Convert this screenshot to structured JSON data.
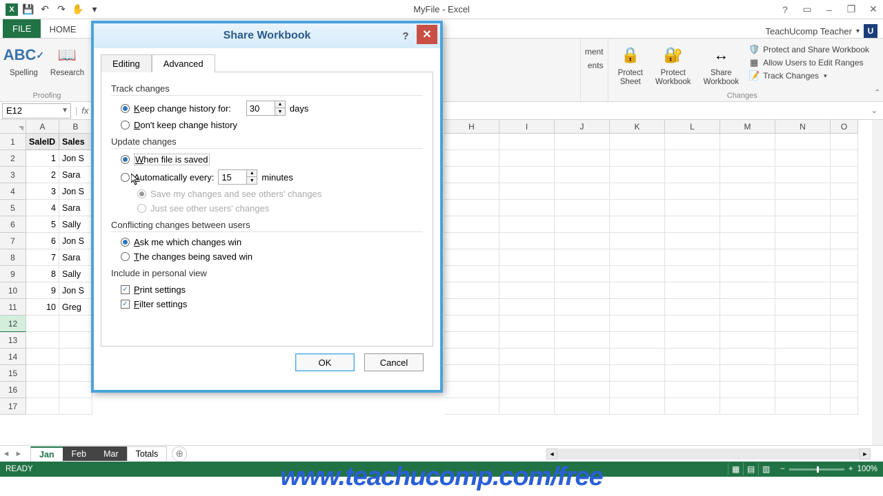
{
  "titlebar": {
    "title": "MyFile - Excel"
  },
  "qat": {
    "save": "💾",
    "undo": "↶",
    "redo": "↷",
    "touch": "✋",
    "more": "▾"
  },
  "win": {
    "help": "?",
    "opts": "▭",
    "min": "–",
    "restore": "❐",
    "close": "✕"
  },
  "tabs": {
    "file": "FILE",
    "home": "HOME"
  },
  "user": {
    "name": "TeachUcomp Teacher",
    "initial": "U"
  },
  "ribbon": {
    "proofing": {
      "spelling": "Spelling",
      "research": "Research",
      "label": "Proofing"
    },
    "protect_sheet": "Protect\nSheet",
    "protect_wb": "Protect\nWorkbook",
    "share_wb": "Share\nWorkbook",
    "psw": "Protect and Share Workbook",
    "auer": "Allow Users to Edit Ranges",
    "tc": "Track Changes",
    "changes_label": "Changes",
    "comment_hint": "ment",
    "comments_hint": "ents"
  },
  "namebox": {
    "ref": "E12"
  },
  "columns": [
    "A",
    "B",
    "H",
    "I",
    "J",
    "K",
    "L",
    "M",
    "N",
    "O"
  ],
  "rows": [
    "1",
    "2",
    "3",
    "4",
    "5",
    "6",
    "7",
    "8",
    "9",
    "10",
    "11",
    "12",
    "13",
    "14",
    "15",
    "16",
    "17"
  ],
  "headers": {
    "a": "SaleID",
    "b": "Sales"
  },
  "data": [
    {
      "id": "1",
      "name": "Jon S"
    },
    {
      "id": "2",
      "name": "Sara"
    },
    {
      "id": "3",
      "name": "Jon S"
    },
    {
      "id": "4",
      "name": "Sara"
    },
    {
      "id": "5",
      "name": "Sally"
    },
    {
      "id": "6",
      "name": "Jon S"
    },
    {
      "id": "7",
      "name": "Sara"
    },
    {
      "id": "8",
      "name": "Sally"
    },
    {
      "id": "9",
      "name": "Jon S"
    },
    {
      "id": "10",
      "name": "Greg"
    }
  ],
  "sheets": {
    "s1": "Jan",
    "s2": "Feb",
    "s3": "Mar",
    "s4": "Totals"
  },
  "status": {
    "ready": "READY",
    "zoom": "100%"
  },
  "dialog": {
    "title": "Share Workbook",
    "tab_editing": "Editing",
    "tab_advanced": "Advanced",
    "sec_track": "Track changes",
    "keep_history": "Keep change history for:",
    "keep_days": "30",
    "days": "days",
    "dont_keep": "Don't keep change history",
    "sec_update": "Update changes",
    "when_saved": "When file is saved",
    "auto_every": "Automatically every:",
    "auto_min": "15",
    "minutes": "minutes",
    "save_mine": "Save my changes and see others' changes",
    "just_see": "Just see other users' changes",
    "sec_conflict": "Conflicting changes between users",
    "ask_me": "Ask me which changes win",
    "saved_win": "The changes being saved win",
    "sec_personal": "Include in personal view",
    "print_s": "Print settings",
    "filter_s": "Filter settings",
    "ok": "OK",
    "cancel": "Cancel"
  },
  "watermark": "www.teachucomp.com/free"
}
